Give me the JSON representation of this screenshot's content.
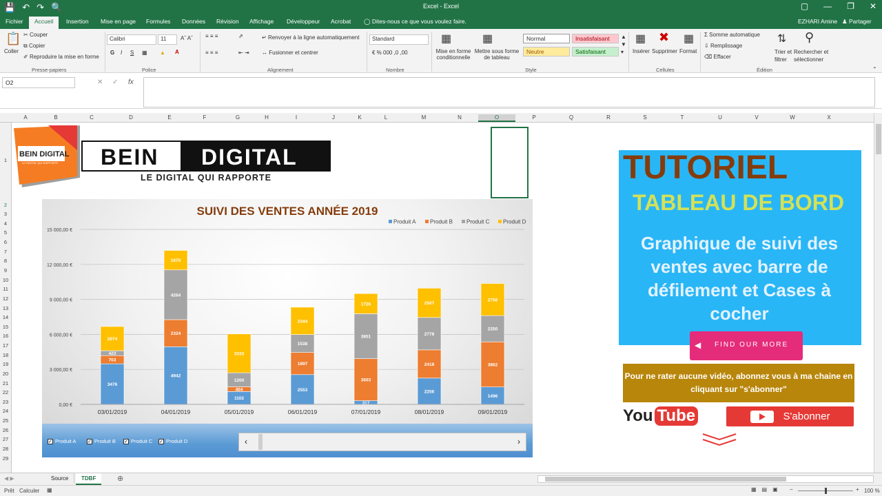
{
  "window": {
    "title": "Excel - Excel",
    "user": "EZHARI Amine",
    "share_label": "Partager"
  },
  "tabs": [
    "Fichier",
    "Accueil",
    "Insertion",
    "Mise en page",
    "Formules",
    "Données",
    "Révision",
    "Affichage",
    "Développeur",
    "Acrobat"
  ],
  "tell_me": "Dites-nous ce que vous voulez faire.",
  "ribbon": {
    "clipboard": {
      "paste": "Coller",
      "cut": "Couper",
      "copy": "Copier",
      "format_painter": "Reproduire la mise en forme",
      "group": "Presse-papiers"
    },
    "font": {
      "name": "Calibri",
      "size": "11",
      "group": "Police",
      "bold": "G",
      "italic": "I",
      "underline": "S"
    },
    "alignment": {
      "wrap": "Renvoyer à la ligne automatiquement",
      "merge": "Fusionner et centrer",
      "group": "Alignement"
    },
    "number": {
      "format": "Standard",
      "group": "Nombre"
    },
    "style": {
      "cond_format": "Mise en forme conditionnelle",
      "table_format": "Mettre sous forme de tableau",
      "normal": "Normal",
      "bad": "Insatisfaisant",
      "neutral": "Neutre",
      "good": "Satisfaisant",
      "group": "Style"
    },
    "cells": {
      "insert": "Insérer",
      "delete": "Supprimer",
      "format": "Format",
      "group": "Cellules"
    },
    "editing": {
      "autosum": "Somme automatique",
      "fill": "Remplissage",
      "clear": "Effacer",
      "sort": "Trier et filtrer",
      "find": "Rechercher et sélectionner",
      "group": "Édition"
    }
  },
  "namebox": "O2",
  "columns": [
    "A",
    "B",
    "C",
    "D",
    "E",
    "F",
    "G",
    "H",
    "I",
    "J",
    "K",
    "L",
    "M",
    "N",
    "O",
    "P",
    "Q",
    "R",
    "S",
    "T",
    "U",
    "V",
    "W",
    "X"
  ],
  "rows": [
    "1",
    "2",
    "3",
    "4",
    "5",
    "6",
    "7",
    "8",
    "9",
    "10",
    "11",
    "12",
    "13",
    "14",
    "15",
    "16",
    "17",
    "18",
    "19",
    "20",
    "21",
    "22",
    "23",
    "24",
    "25",
    "26",
    "27",
    "28",
    "29"
  ],
  "logo": {
    "brand": "BEIN DIGITAL",
    "tag": "LE DIGITAL QUI RAPPORTE"
  },
  "banner": {
    "word1": "BEIN",
    "word2": "DIGITAL",
    "tagline": "LE DIGITAL QUI RAPPORTE"
  },
  "chart_data": {
    "type": "bar",
    "stacked": true,
    "title": "SUIVI DES VENTES ANNÉE 2019",
    "categories": [
      "03/01/2019",
      "04/01/2019",
      "05/01/2019",
      "06/01/2019",
      "07/01/2019",
      "08/01/2019",
      "09/01/2019"
    ],
    "series": [
      {
        "name": "Produit A",
        "color": "#5b9bd5",
        "values": [
          3476,
          4942,
          1102,
          2553,
          317,
          2256,
          1496
        ]
      },
      {
        "name": "Produit B",
        "color": "#ed7d31",
        "values": [
          703,
          2324,
          404,
          1897,
          3603,
          2418,
          3862
        ]
      },
      {
        "name": "Produit C",
        "color": "#a5a5a5",
        "values": [
          423,
          4264,
          1200,
          1538,
          3851,
          2778,
          2250
        ]
      },
      {
        "name": "Produit D",
        "color": "#ffc000",
        "values": [
          2074,
          1670,
          3333,
          2344,
          1726,
          2507,
          2756
        ]
      }
    ],
    "yticks": [
      "0,00 €",
      "3 000,00 €",
      "6 000,00 €",
      "9 000,00 €",
      "12 000,00 €",
      "15 000,00 €"
    ],
    "ylim": [
      0,
      15000
    ],
    "legend": "top-right",
    "grid": true
  },
  "checkboxes": [
    "Produit A",
    "Produit B",
    "Produit C",
    "Produit D"
  ],
  "tutorial": {
    "title": "TUTORIEL",
    "subtitle": "TABLEAU DE BORD",
    "desc1": "Graphique de suivi des",
    "desc2": "ventes avec barre de",
    "desc3": "défilement et Cases à",
    "desc4": "cocher"
  },
  "find_more": "FIND OUR MORE",
  "youtube": {
    "line1": "Pour ne rater aucune vidéo, abonnez vous à ma chaine en",
    "line2": "cliquant sur \"s'abonner\"",
    "you": "You",
    "tube": "Tube",
    "subscribe": "S'abonner"
  },
  "sheets": [
    "Source",
    "TDBF"
  ],
  "status": {
    "ready": "Prêt",
    "calc": "Calculer",
    "zoom": "100 %"
  }
}
